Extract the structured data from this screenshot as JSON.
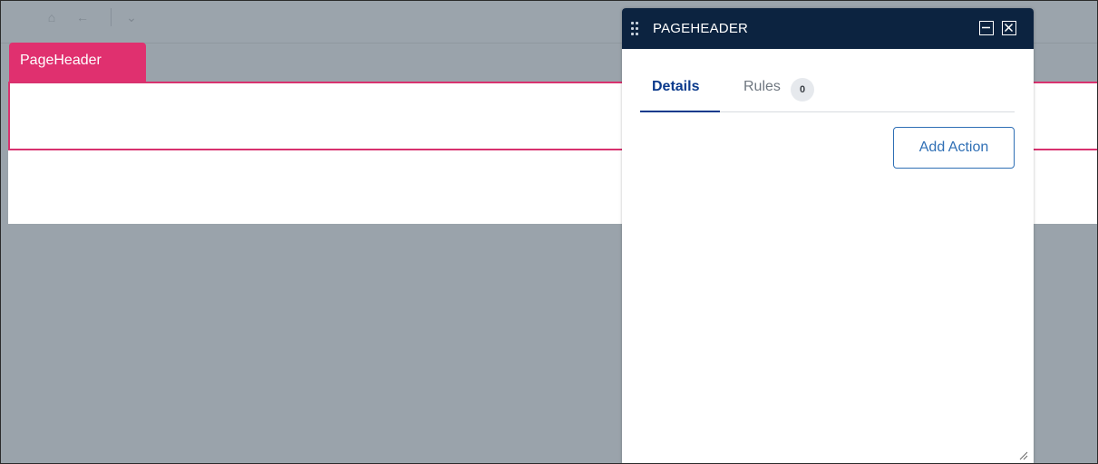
{
  "toolbar": {
    "icons": [
      "home-icon",
      "back-arrow-icon",
      "chevron-down-icon"
    ]
  },
  "canvas": {
    "tag_label": "PageHeader"
  },
  "panel": {
    "title": "PAGEHEADER",
    "tabs": [
      {
        "label": "Details",
        "active": true
      },
      {
        "label": "Rules",
        "badge": "0",
        "active": false
      }
    ],
    "add_action_label": "Add Action"
  },
  "colors": {
    "accent_pink": "#e0306f",
    "panel_header": "#0c2340",
    "tab_active": "#0b3a8c",
    "button_blue": "#2f6fb5",
    "overlay_gray": "#9aa3ab"
  }
}
